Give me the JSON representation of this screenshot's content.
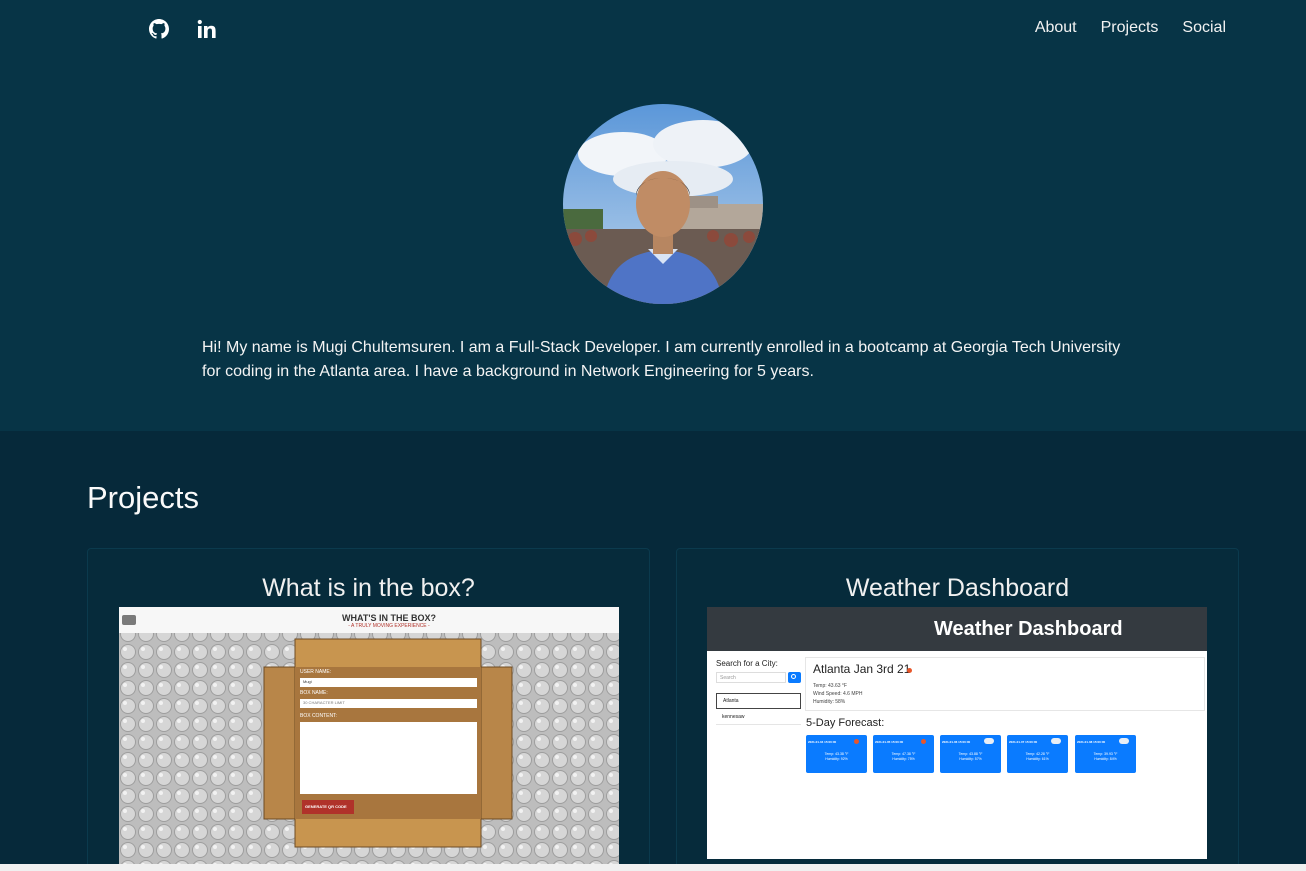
{
  "nav": {
    "icons": [
      "github-icon",
      "linkedin-icon"
    ],
    "links": [
      "About",
      "Projects",
      "Social"
    ]
  },
  "hero": {
    "bio": "Hi! My name is Mugi Chultemsuren. I am a Full-Stack Developer. I am currently enrolled in a bootcamp at Georgia Tech University for coding in the Atlanta area. I have a background in Network Engineering for 5 years."
  },
  "projects": {
    "title": "Projects",
    "cards": [
      {
        "title": "What is in the box?",
        "shot": {
          "heading": "WHAT'S IN THE BOX?",
          "subheading": "- A TRULY MOVING EXPERIENCE -",
          "user_label": "USER NAME:",
          "user_value": "Mugi",
          "box_label": "BOX NAME:",
          "box_value": "30 CHARACTER LIMIT",
          "content_label": "BOX CONTENT:",
          "button": "GENERATE QR CODE"
        }
      },
      {
        "title": "Weather Dashboard",
        "shot": {
          "header": "Weather Dashboard",
          "search_label": "Search for a City:",
          "search_placeholder": "Search",
          "cities": [
            "Atlanta",
            "kennesaw"
          ],
          "current_city": "Atlanta Jan 3rd 21",
          "temp": "Temp: 43.63 °F",
          "wind": "Wind Speed: 4.6 MPH",
          "humidity": "Humidity: 58%",
          "forecast_title": "5-Day Forecast:",
          "forecast": [
            {
              "date": "2021-01-04 15:00:00",
              "temp": "Temp: 43.38 °F",
              "hum": "Humidity: 92%"
            },
            {
              "date": "2021-01-05 15:00:00",
              "temp": "Temp: 47.38 °F",
              "hum": "Humidity: 75%"
            },
            {
              "date": "2021-01-06 15:00:00",
              "temp": "Temp: 43.88 °F",
              "hum": "Humidity: 57%"
            },
            {
              "date": "2021-01-07 15:00:00",
              "temp": "Temp: 42.28 °F",
              "hum": "Humidity: 61%"
            },
            {
              "date": "2021-01-08 15:00:00",
              "temp": "Temp: 39.93 °F",
              "hum": "Humidity: 84%"
            }
          ]
        }
      }
    ]
  },
  "colors": {
    "hero_bg": "#073446",
    "page_bg": "#06293a",
    "accent_blue": "#0a7bff"
  }
}
